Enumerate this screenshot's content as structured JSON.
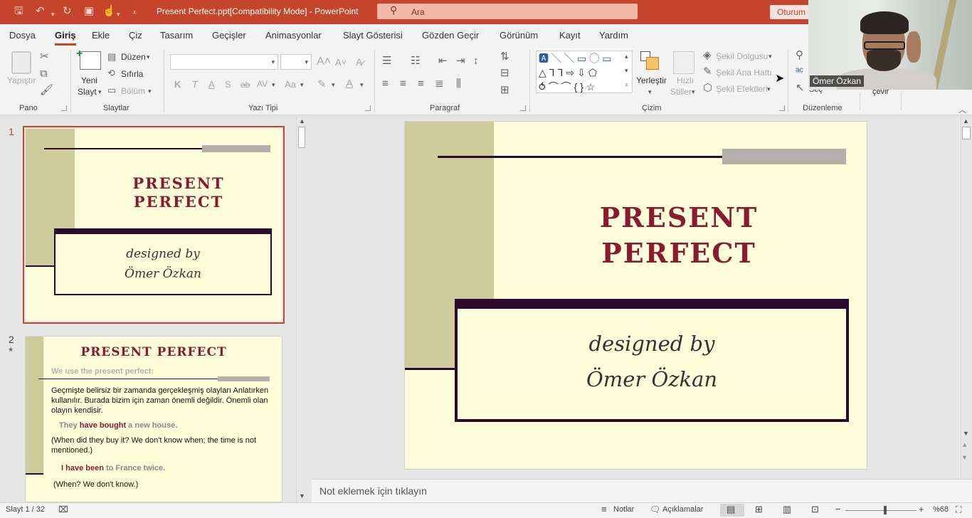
{
  "titlebar": {
    "doc_title": "Present Perfect.ppt[Compatibility Mode]  -  PowerPoint",
    "search_placeholder": "Ara",
    "signin_label": "Oturum"
  },
  "menu": {
    "tabs": [
      "Dosya",
      "Giriş",
      "Ekle",
      "Çiz",
      "Tasarım",
      "Geçişler",
      "Animasyonlar",
      "Slayt Gösterisi",
      "Gözden Geçir",
      "Görünüm",
      "Kayıt",
      "Yardım"
    ],
    "active": "Giriş"
  },
  "ribbon": {
    "pano": {
      "label": "Pano",
      "paste": "Yapıştır"
    },
    "slaytlar": {
      "label": "Slaytlar",
      "new_slide_1": "Yeni",
      "new_slide_2": "Slayt",
      "layout": "Düzen",
      "reset": "Sıfırla",
      "section": "Bölüm"
    },
    "yazi_tipi": {
      "label": "Yazı Tipi",
      "bold": "K",
      "italic": "T",
      "underline": "A",
      "shadow": "S",
      "strike": "ab",
      "spacing": "AV",
      "case": "Aa"
    },
    "paragraf": {
      "label": "Paragraf"
    },
    "cizim": {
      "label": "Çizim",
      "arrange": "Yerleştir",
      "quick_styles_1": "Hızlı",
      "quick_styles_2": "Stiller",
      "shape_fill": "Şekil Dolgusu",
      "shape_outline": "Şekil Ana Hattı",
      "shape_effects": "Şekil Efektleri"
    },
    "duzenleme": {
      "label": "Düzenleme",
      "select": "Seç",
      "translate": "çevir"
    }
  },
  "webcam": {
    "name": "Ömer Özkan"
  },
  "slides": [
    {
      "number": "1",
      "title_line1": "PRESENT",
      "title_line2": "PERFECT",
      "subtitle_line1": "designed by",
      "subtitle_line2": "Ömer Özkan"
    },
    {
      "number": "2",
      "star": "★",
      "title": "PRESENT PERFECT",
      "intro": "We use the present perfect:",
      "para": "Geçmişte belirsiz bir zamanda gerçekleşmiş olayları Anlatırken kullanılır. Burada bizim için zaman önemli değildir. Önemli olan olayın kendisir.",
      "ex1_a": "They ",
      "ex1_b": "have bought",
      "ex1_c": " a new house.",
      "ex1_note": "(When did they buy it? We don't know when; the time is not mentioned.)",
      "ex2_a": "I ",
      "ex2_b": "have been",
      "ex2_c": " to France twice.",
      "ex2_note": "(When? We don't know.)"
    }
  ],
  "notes": {
    "placeholder": "Not eklemek için tıklayın"
  },
  "status": {
    "slide_count": "Slayt 1 / 32",
    "notes": "Notlar",
    "comments": "Açıklamalar",
    "zoom": "%68",
    "zoom_fraction": 0.56
  },
  "colors": {
    "accent": "#c4452c",
    "slide_bg": "#fffedb",
    "sidebar": "#cfcc9c",
    "title": "#8b1a2e",
    "frame": "#2b0a2e"
  }
}
